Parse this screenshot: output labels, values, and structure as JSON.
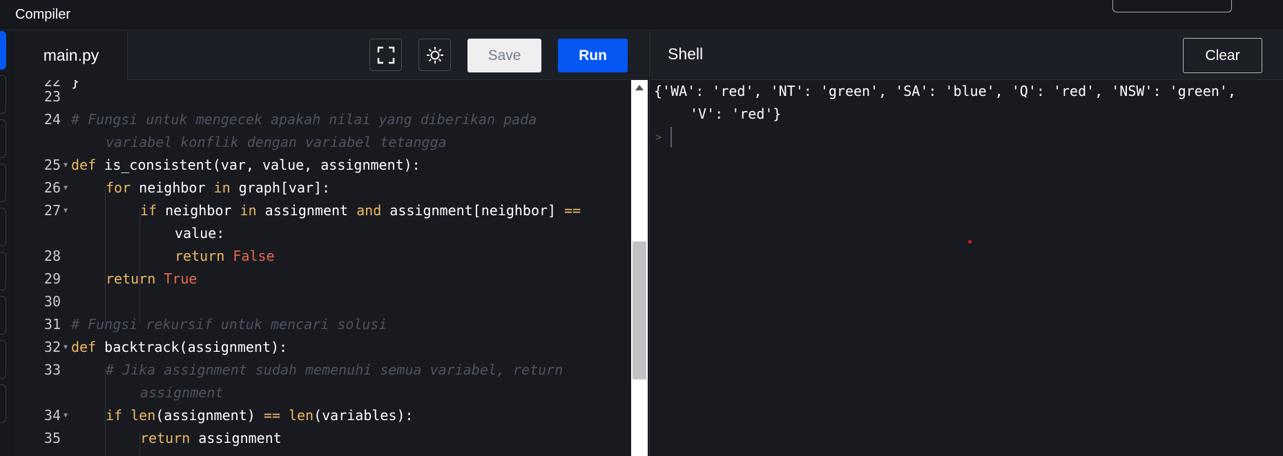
{
  "app": {
    "title": "Compiler"
  },
  "editor": {
    "file_tab": "main.py",
    "icons": {
      "fullscreen": "fullscreen-icon",
      "theme": "sun-icon"
    },
    "save_label": "Save",
    "run_label": "Run",
    "lines": [
      {
        "num": "22",
        "text": "}"
      },
      {
        "num": "23",
        "text": ""
      },
      {
        "num": "24",
        "text": "# Fungsi untuk mengecek apakah nilai yang diberikan pada"
      },
      {
        "num": "",
        "text": "variabel konflik dengan variabel tetangga"
      },
      {
        "num": "25",
        "text": "def is_consistent(var, value, assignment):"
      },
      {
        "num": "26",
        "text": "for neighbor in graph[var]:"
      },
      {
        "num": "27",
        "text": "if neighbor in assignment and assignment[neighbor] =="
      },
      {
        "num": "",
        "text": "value:"
      },
      {
        "num": "28",
        "text": "return False"
      },
      {
        "num": "29",
        "text": "return True"
      },
      {
        "num": "30",
        "text": ""
      },
      {
        "num": "31",
        "text": "# Fungsi rekursif untuk mencari solusi"
      },
      {
        "num": "32",
        "text": "def backtrack(assignment):"
      },
      {
        "num": "33",
        "text": "# Jika assignment sudah memenuhi semua variabel, return"
      },
      {
        "num": "",
        "text": "assignment"
      },
      {
        "num": "34",
        "text": "if len(assignment) == len(variables):"
      },
      {
        "num": "35",
        "text": "return assignment"
      }
    ]
  },
  "shell": {
    "title": "Shell",
    "clear_label": "Clear",
    "output": [
      "{'WA': 'red', 'NT': 'green', 'SA': 'blue', 'Q': 'red', 'NSW': 'green',",
      "'V': 'red'}"
    ],
    "prompt": ">"
  },
  "colors": {
    "accent": "#0556f3",
    "keyword": "#f0b963",
    "comment": "#4d5360",
    "boolean": "#e66a4a",
    "background": "#181a20"
  }
}
